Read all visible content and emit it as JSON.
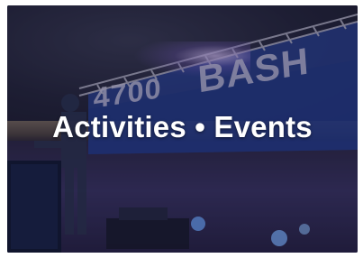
{
  "tile": {
    "headline": "Activities • Events",
    "background_banner_left": "4700",
    "background_banner_right": "BASH"
  },
  "colors": {
    "overlay": "#14122866",
    "text": "#ffffff",
    "banner_blue": "#2a48a8"
  },
  "icons": [
    "stage-truss-icon",
    "speaker-icon",
    "spotlight-icon"
  ]
}
